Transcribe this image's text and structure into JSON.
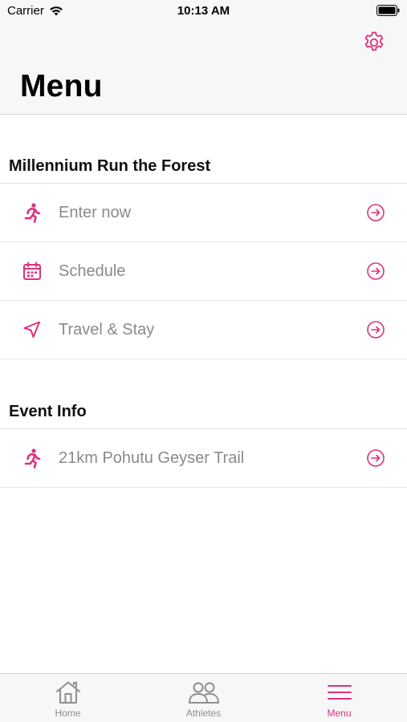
{
  "status_bar": {
    "carrier": "Carrier",
    "time": "10:13 AM"
  },
  "header": {
    "title": "Menu",
    "settings_icon": "gear-icon"
  },
  "accent_color": "#e0307d",
  "sections": [
    {
      "title": "Millennium Run the Forest",
      "items": [
        {
          "label": "Enter now",
          "icon": "runner-icon"
        },
        {
          "label": "Schedule",
          "icon": "calendar-icon"
        },
        {
          "label": "Travel & Stay",
          "icon": "navigation-arrow-icon"
        }
      ]
    },
    {
      "title": "Event Info",
      "items": [
        {
          "label": "21km Pohutu Geyser Trail",
          "icon": "runner-icon"
        }
      ]
    }
  ],
  "tabbar": {
    "tabs": [
      {
        "label": "Home",
        "icon": "home-icon",
        "active": false
      },
      {
        "label": "Athletes",
        "icon": "people-icon",
        "active": false
      },
      {
        "label": "Menu",
        "icon": "menu-icon",
        "active": true
      }
    ]
  }
}
